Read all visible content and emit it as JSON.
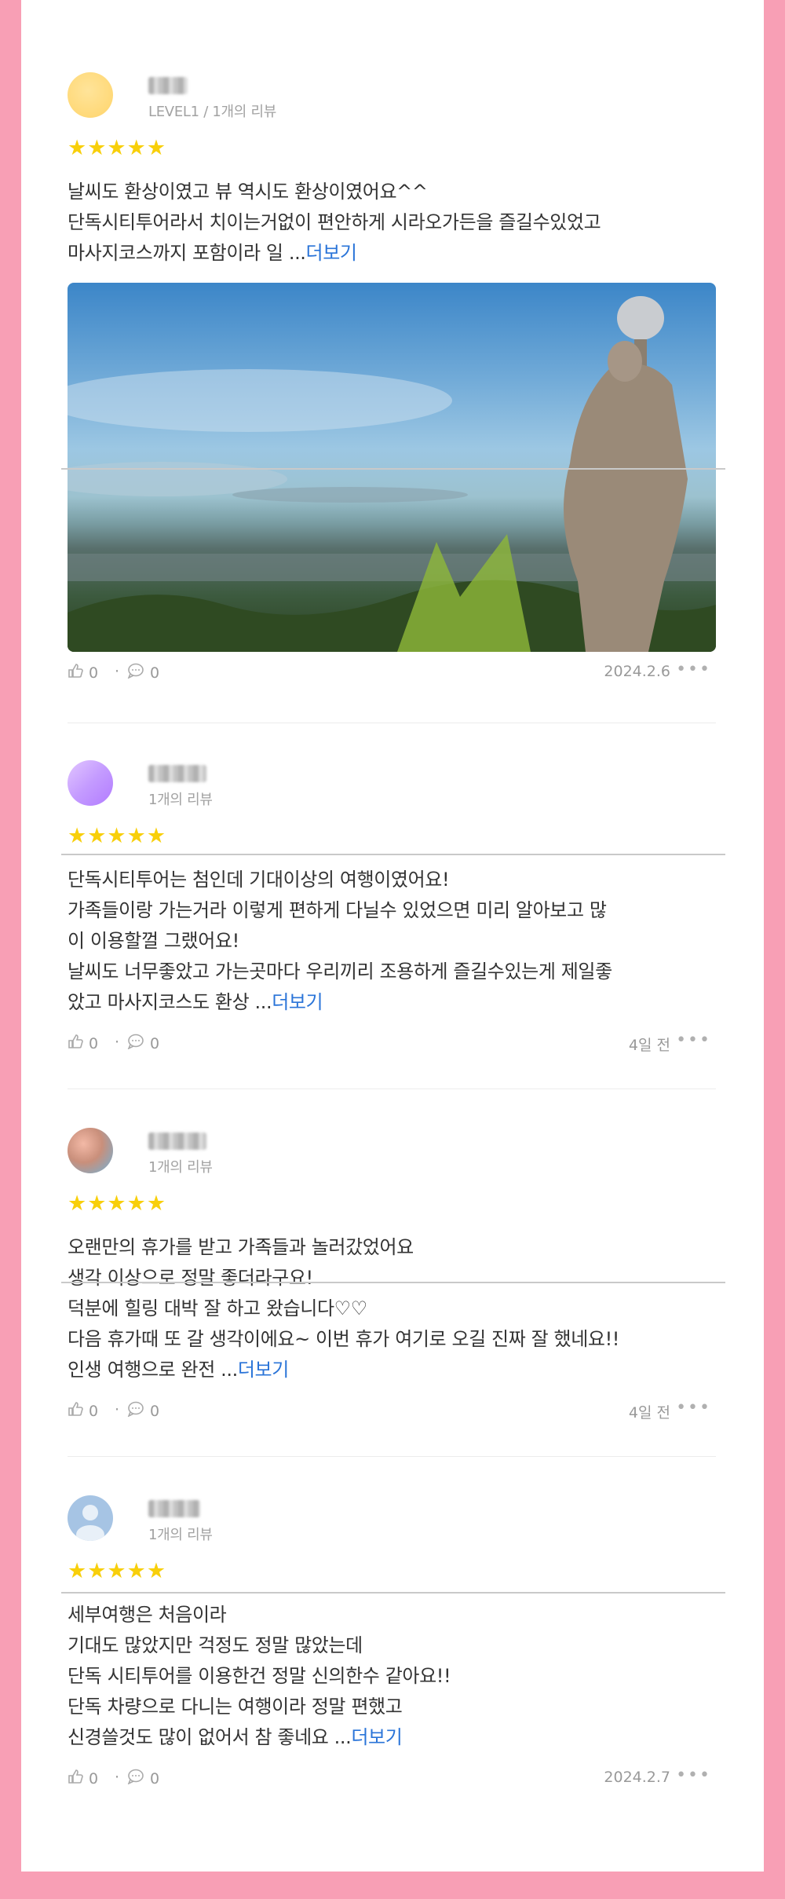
{
  "reviews": [
    {
      "meta": "LEVEL1 / 1개의 리뷰",
      "stars": "★★★★★",
      "lines": [
        "날씨도 환상이였고 뷰 역시도 환상이였어요^^",
        "단독시티투어라서 치이는거없이 편안하게 시라오가든을 즐길수있었고",
        "마사지코스까지 포함이라 일 ..."
      ],
      "more": "더보기",
      "likes": "0",
      "comments": "0",
      "date": "2024.2.6",
      "menu": "•••"
    },
    {
      "meta": "1개의 리뷰",
      "stars": "★★★★★",
      "lines": [
        "단독시티투어는 첨인데 기대이상의 여행이였어요!",
        "가족들이랑 가는거라 이렇게 편하게 다닐수 있었으면 미리 알아보고 많",
        "이 이용할껄 그랬어요!",
        "날씨도 너무좋았고 가는곳마다 우리끼리 조용하게 즐길수있는게 제일좋",
        "았고 마사지코스도 환상 ..."
      ],
      "more": "더보기",
      "likes": "0",
      "comments": "0",
      "date": "4일 전",
      "menu": "•••"
    },
    {
      "meta": "1개의 리뷰",
      "stars": "★★★★★",
      "lines": [
        "오랜만의 휴가를 받고 가족들과 놀러갔었어요",
        "생각 이상으로 정말 좋더라구요!",
        "덕분에 힐링 대박 잘 하고 왔습니다♡♡",
        "다음 휴가때 또 갈 생각이에요~ 이번 휴가 여기로 오길 진짜 잘 했네요!!",
        "인생 여행으로 완전 ..."
      ],
      "more": "더보기",
      "likes": "0",
      "comments": "0",
      "date": "4일 전",
      "menu": "•••"
    },
    {
      "meta": "1개의 리뷰",
      "stars": "★★★★★",
      "lines": [
        "세부여행은 처음이라",
        "기대도 많았지만 걱정도 정말 많았는데",
        "단독 시티투어를 이용한건 정말 신의한수 같아요!!",
        "단독 차량으로 다니는 여행이라 정말 편했고",
        "신경쓸것도 많이 없어서 참 좋네요 ..."
      ],
      "more": "더보기",
      "likes": "0",
      "comments": "0",
      "date": "2024.2.7",
      "menu": "•••"
    }
  ],
  "colors": {
    "background": "#f89fb5",
    "star": "#f8cf0a",
    "link": "#2a74d8"
  },
  "icons": {
    "like": "thumbs-up-icon",
    "comment": "comment-bubble-icon",
    "menu": "more-options-icon"
  }
}
